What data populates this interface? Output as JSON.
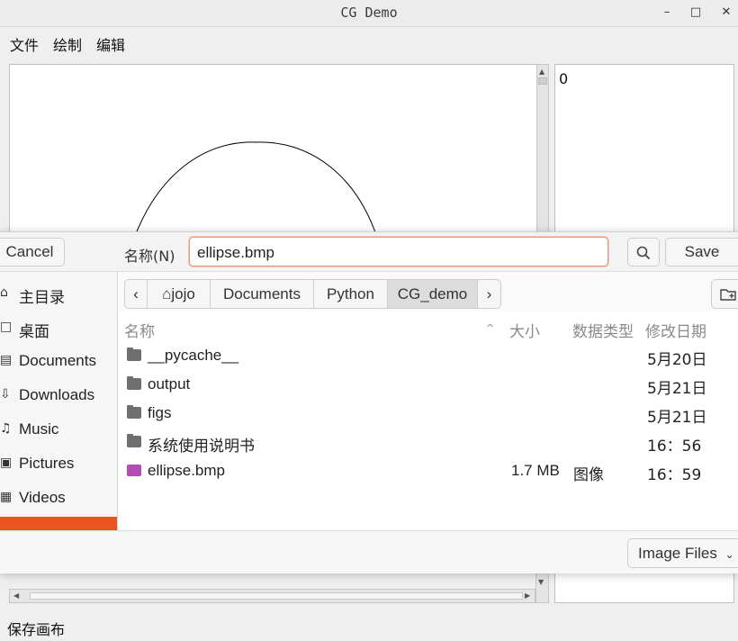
{
  "window": {
    "title": "CG Demo",
    "min_glyph": "–",
    "max_glyph": "□",
    "close_glyph": "✕"
  },
  "menu": [
    "文件",
    "绘制",
    "编辑"
  ],
  "side_panel": {
    "value": "0"
  },
  "status_bar": {
    "text": "保存画布"
  },
  "dialog": {
    "cancel_label": "Cancel",
    "save_label": "Save",
    "name_label": "名称(N)",
    "filename": "ellipse.bmp",
    "sidebar": [
      {
        "icon": "home-icon",
        "glyph": "⌂",
        "label": "主目录"
      },
      {
        "icon": "desktop-icon",
        "glyph": "□",
        "label": "桌面"
      },
      {
        "icon": "documents-icon",
        "glyph": "▤",
        "label": "Documents"
      },
      {
        "icon": "downloads-icon",
        "glyph": "⇩",
        "label": "Downloads"
      },
      {
        "icon": "music-icon",
        "glyph": "♫",
        "label": "Music"
      },
      {
        "icon": "pictures-icon",
        "glyph": "▣",
        "label": "Pictures"
      },
      {
        "icon": "videos-icon",
        "glyph": "▦",
        "label": "Videos"
      }
    ],
    "path": [
      "jojo",
      "Documents",
      "Python",
      "CG_demo"
    ],
    "columns": {
      "name": "名称",
      "size": "大小",
      "type": "数据类型",
      "modified": "修改日期"
    },
    "files": [
      {
        "kind": "folder",
        "name": "__pycache__",
        "size": "",
        "type": "",
        "modified": "5月20日"
      },
      {
        "kind": "folder",
        "name": "output",
        "size": "",
        "type": "",
        "modified": "5月21日"
      },
      {
        "kind": "folder",
        "name": "figs",
        "size": "",
        "type": "",
        "modified": "5月21日"
      },
      {
        "kind": "folder",
        "name": "系统使用说明书",
        "size": "",
        "type": "",
        "modified": "16：56"
      },
      {
        "kind": "image",
        "name": "ellipse.bmp",
        "size": "1.7 MB",
        "type": "图像",
        "modified": "16：59"
      }
    ],
    "filter": "Image Files",
    "accent_color": "#e95420"
  }
}
